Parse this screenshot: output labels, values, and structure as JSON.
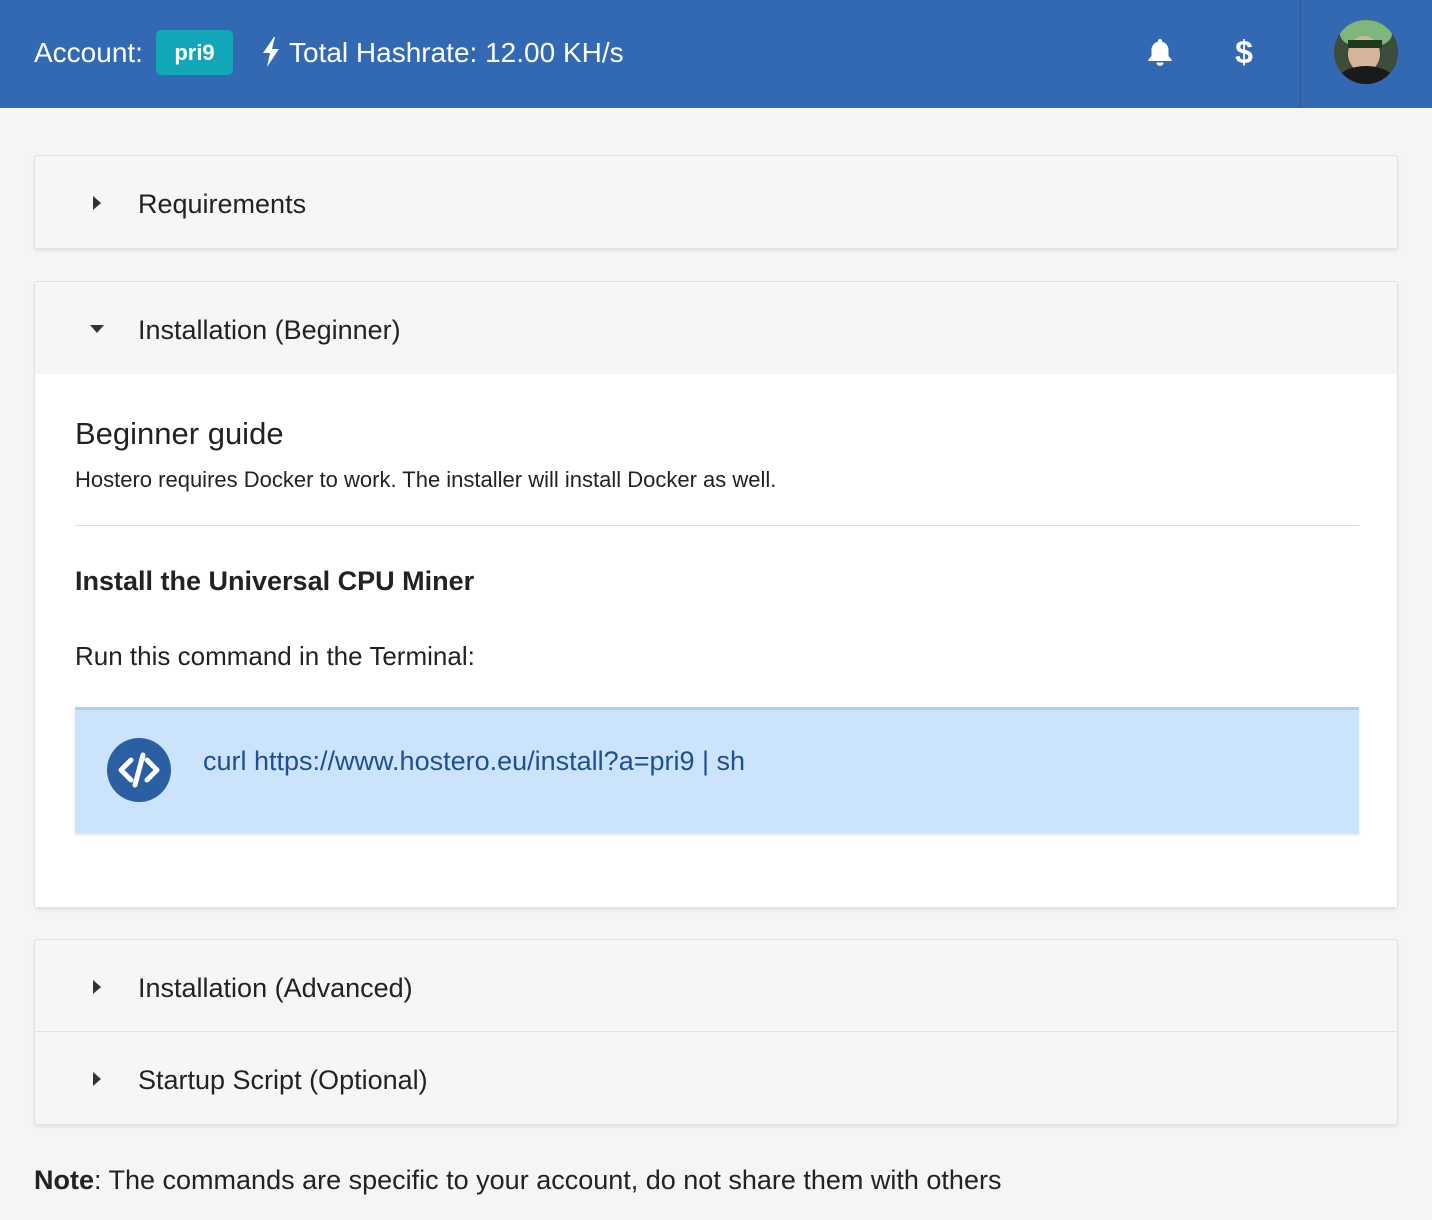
{
  "header": {
    "account_label": "Account:",
    "account_id": "pri9",
    "hashrate_text": "Total Hashrate: 12.00 KH/s",
    "dollar_symbol": "$"
  },
  "accordion": [
    {
      "title": "Requirements",
      "state": "collapsed"
    },
    {
      "title": "Installation (Beginner)",
      "state": "expanded"
    },
    {
      "title": "Installation (Advanced)",
      "state": "collapsed"
    },
    {
      "title": "Startup Script (Optional)",
      "state": "collapsed"
    }
  ],
  "beginner": {
    "title": "Beginner guide",
    "subtitle": "Hostero requires Docker to work. The installer will install Docker as well.",
    "section_title": "Install the Universal CPU Miner",
    "run_text": "Run this command in the Terminal:",
    "command": "curl https://www.hostero.eu/install?a=pri9 | sh"
  },
  "note": {
    "label": "Note",
    "text": ": The commands are specific to your account, do not share them with others"
  },
  "colors": {
    "topbar": "#3269b2",
    "badge": "#11a6b8",
    "command_bg": "#cbe3fb",
    "command_text": "#1f4f93",
    "code_icon": "#2a5fa3"
  }
}
